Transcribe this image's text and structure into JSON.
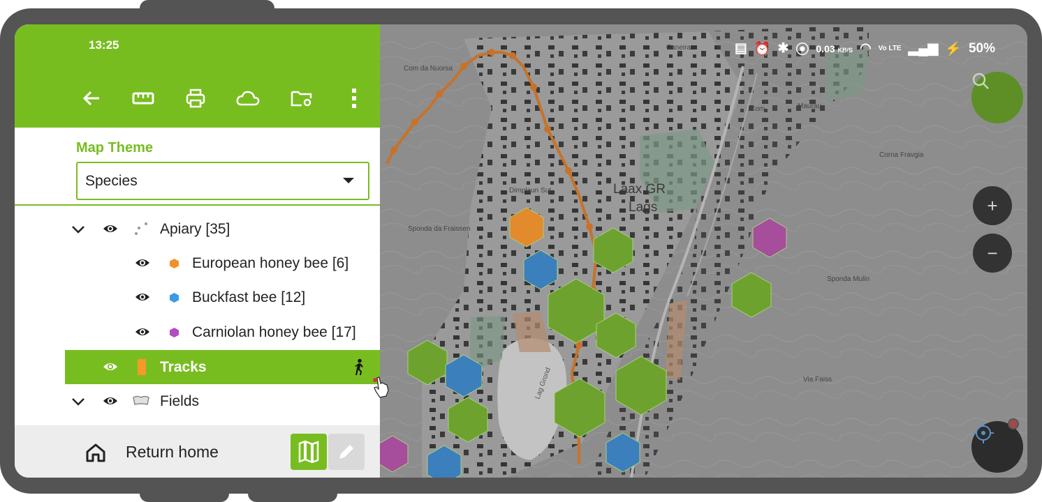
{
  "status": {
    "time": "13:25",
    "network_speed": "0.03",
    "network_unit": "KB/S",
    "volte": "Vo LTE",
    "battery": "50%"
  },
  "toolbar": {
    "icons": [
      "back-arrow-icon",
      "ruler-icon",
      "print-icon",
      "cloud-icon",
      "folder-settings-icon",
      "more-vert-icon"
    ]
  },
  "theme": {
    "label": "Map Theme",
    "selected": "Species"
  },
  "layers": [
    {
      "label": "Apiary [35]",
      "expanded": true,
      "visible": true,
      "symbol": "points"
    },
    {
      "label": "European honey bee [6]",
      "visible": true,
      "color": "#f0922b"
    },
    {
      "label": "Buckfast bee [12]",
      "visible": true,
      "color": "#3b9ae6"
    },
    {
      "label": "Carniolan honey bee [17]",
      "visible": true,
      "color": "#b04dc2"
    },
    {
      "label": "Tracks",
      "visible": true,
      "selected": true,
      "color": "#f39a2a"
    },
    {
      "label": "Fields",
      "expanded": true,
      "visible": true,
      "symbol": "polygon"
    }
  ],
  "footer": {
    "home_label": "Return home"
  },
  "map": {
    "place_label_1": "Laax GR",
    "place_label_2": "Lags",
    "street_labels": [
      "Com da Nuorsa",
      "Dimplaun Sut",
      "Sponda da Fraissen",
      "Corna Fravgia",
      "Sponda Mulin",
      "Via Faiss",
      "Caneira",
      "Lag Grond",
      "Maurau",
      "Com"
    ],
    "colors": {
      "accent": "#78bd20",
      "map_green_hex": "#6ea22f",
      "map_blue_hex": "#3b7fbd",
      "map_orange_hex": "#e28a2c",
      "map_purple_hex": "#a64d9c",
      "track": "#d67523"
    }
  }
}
